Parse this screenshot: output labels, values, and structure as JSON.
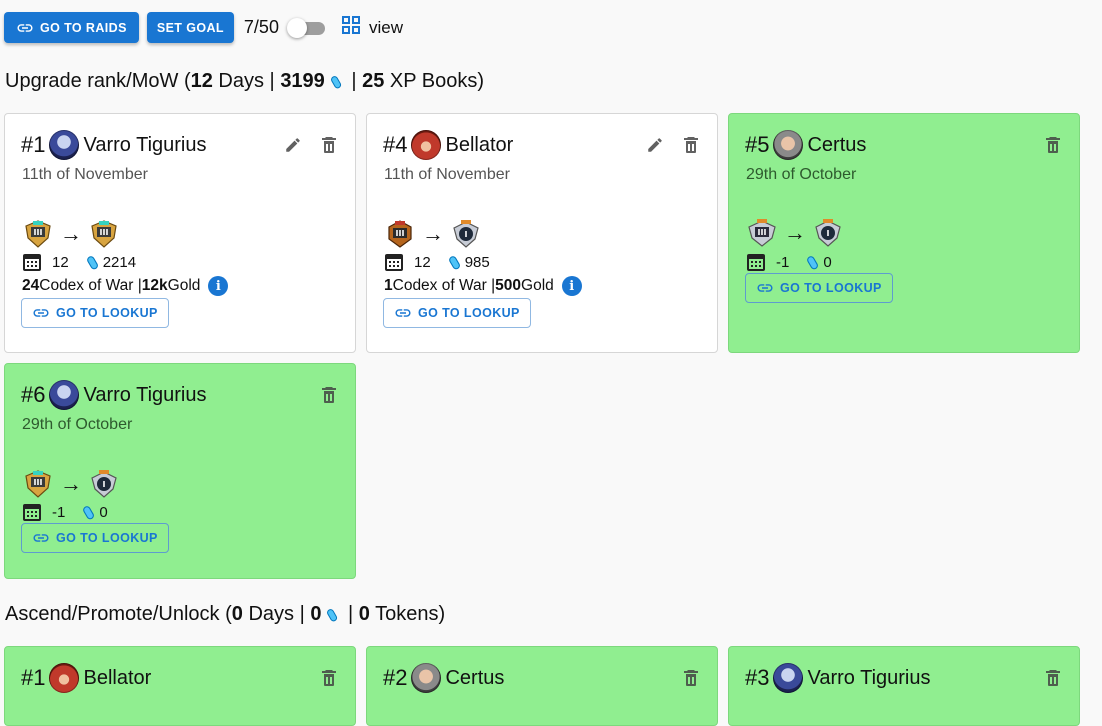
{
  "toolbar": {
    "go_to_raids": "GO TO RAIDS",
    "set_goal": "SET GOAL",
    "count": "7/50",
    "view_label": "view",
    "accent_color": "#1976d2"
  },
  "upgrade_section": {
    "title_prefix": "Upgrade rank/MoW (",
    "days": "12",
    "days_label": " Days | ",
    "shards": "3199",
    "sep": " | ",
    "books": "25",
    "books_label": " XP Books)"
  },
  "upgrade_cards": [
    {
      "num": "#1",
      "name": "Varro Tigurius",
      "date": "11th of November",
      "days": "12",
      "energy": "2214",
      "codex": "24",
      "codex_label": " Codex of War | ",
      "gold": "12k",
      "gold_label": " Gold",
      "button": "GO TO LOOKUP",
      "done": false
    },
    {
      "num": "#4",
      "name": "Bellator",
      "date": "11th of November",
      "days": "12",
      "energy": "985",
      "codex": "1",
      "codex_label": " Codex of War | ",
      "gold": "500",
      "gold_label": " Gold",
      "button": "GO TO LOOKUP",
      "done": false
    },
    {
      "num": "#5",
      "name": "Certus",
      "date": "29th of October",
      "days": "-1",
      "energy": "0",
      "button": "GO TO LOOKUP",
      "done": true
    },
    {
      "num": "#6",
      "name": "Varro Tigurius",
      "date": "29th of October",
      "days": "-1",
      "energy": "0",
      "button": "GO TO LOOKUP",
      "done": true
    }
  ],
  "ascend_section": {
    "title_prefix": "Ascend/Promote/Unlock (",
    "days": "0",
    "days_label": " Days | ",
    "shards": "0",
    "sep": " | ",
    "tokens": "0",
    "tokens_label": " Tokens)"
  },
  "ascend_cards": [
    {
      "num": "#1",
      "name": "Bellator",
      "done": true
    },
    {
      "num": "#2",
      "name": "Certus",
      "done": true
    },
    {
      "num": "#3",
      "name": "Varro Tigurius",
      "done": true
    }
  ],
  "icons": {
    "link": "link-icon",
    "grid": "grid-view-icon",
    "edit": "pencil-icon",
    "delete": "trash-icon",
    "calendar": "calendar-icon",
    "shard": "blue-shard-icon",
    "info": "info-icon",
    "arrow": "arrow-right-icon"
  }
}
